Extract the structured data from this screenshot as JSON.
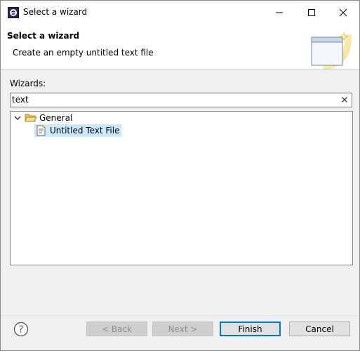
{
  "window": {
    "title": "Select a wizard"
  },
  "header": {
    "title": "Select a wizard",
    "description": "Create an empty untitled text file"
  },
  "wizards": {
    "label": "Wizards:",
    "filter_value": "text",
    "tree": [
      {
        "label": "General",
        "expanded": true,
        "icon": "folder-open-icon"
      },
      {
        "label": "Untitled Text File",
        "icon": "text-file-icon",
        "selected": true
      }
    ]
  },
  "buttons": {
    "back": "< Back",
    "next": "Next >",
    "finish": "Finish",
    "cancel": "Cancel"
  },
  "colors": {
    "selection": "#cce8ff",
    "default_button_border": "#0078d7"
  }
}
